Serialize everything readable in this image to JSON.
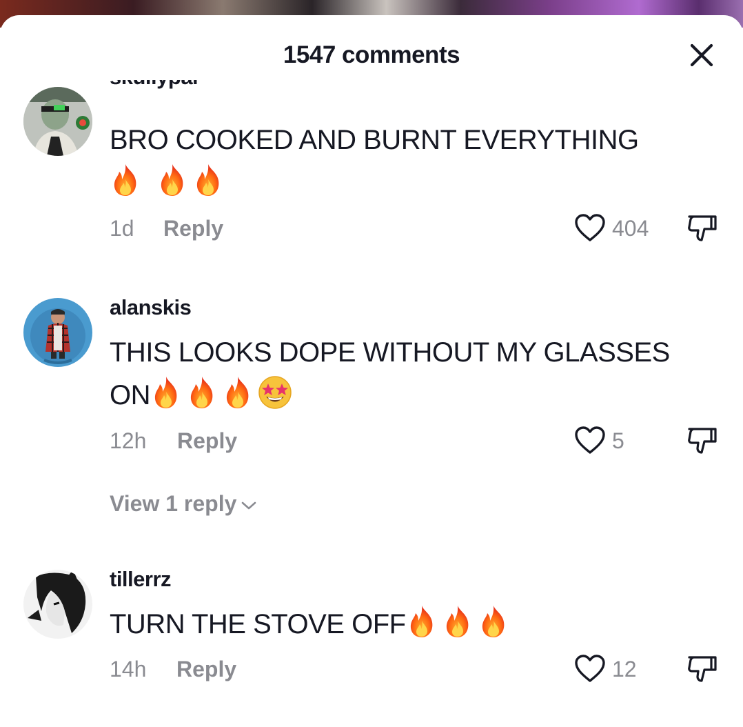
{
  "header": {
    "title": "1547 comments"
  },
  "comments": [
    {
      "username": "skullypal",
      "text": "BRO COOKED AND BURNT EVERYTHING",
      "emojis": [
        "fire-emoji",
        "fire-emoji",
        "fire-emoji"
      ],
      "time": "1d",
      "reply_label": "Reply",
      "likes": "404"
    },
    {
      "username": "alanskis",
      "text_line1": "THIS LOOKS DOPE WITHOUT MY GLASSES",
      "text_line2": "ON",
      "emojis": [
        "fire-emoji",
        "fire-emoji",
        "fire-emoji",
        "star-struck-emoji"
      ],
      "time": "12h",
      "reply_label": "Reply",
      "likes": "5",
      "view_replies_label": "View 1 reply"
    },
    {
      "username": "tillerrz",
      "text": "TURN THE STOVE OFF",
      "emojis": [
        "fire-emoji",
        "fire-emoji",
        "fire-emoji"
      ],
      "time": "14h",
      "reply_label": "Reply",
      "likes": "12"
    }
  ],
  "colors": {
    "text_primary": "#161823",
    "text_secondary": "#8a8b91",
    "background": "#ffffff"
  },
  "icons": [
    "close-icon",
    "heart-icon",
    "dislike-icon",
    "chevron-down-icon",
    "fire-emoji",
    "star-struck-emoji"
  ]
}
